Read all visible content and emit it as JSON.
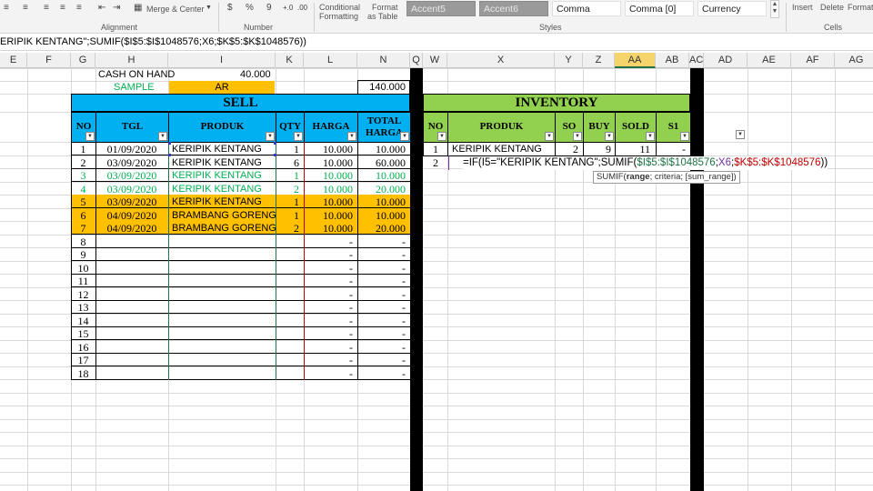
{
  "ribbon": {
    "merge_center": "Merge & Center",
    "percent": "%",
    "comma_sym": "9",
    "alignment_label": "Alignment",
    "number_label": "Number",
    "styles_label": "Styles",
    "cells_label": "Cells",
    "cond_fmt_1": "Conditional",
    "cond_fmt_2": "Formatting",
    "fmt_table_1": "Format",
    "fmt_table_2": "as Table",
    "style_accent5": "Accent5",
    "style_accent6": "Accent6",
    "style_comma": "Comma",
    "style_comma0": "Comma [0]",
    "style_currency": "Currency",
    "insert": "Insert",
    "delete": "Delete",
    "format": "Format"
  },
  "formula_bar": "ERIPIK KENTANG\";SUMIF($I$5:$I$1048576;X6;$K$5:$K$1048576))",
  "columns": [
    "E",
    "F",
    "G",
    "H",
    "I",
    "K",
    "L",
    "N",
    "Q",
    "W",
    "X",
    "Y",
    "Z",
    "AA",
    "AB",
    "AC",
    "AD",
    "AE",
    "AF",
    "AG"
  ],
  "top": {
    "cash_label": "CASH ON HAND",
    "cash_value": "40.000",
    "sample_label": "SAMPLE",
    "ar_label": "AR",
    "n_value": "140.000"
  },
  "sell": {
    "title": "SELL",
    "headers": [
      "NO",
      "TGL",
      "PRODUK",
      "QTY",
      "HARGA",
      "TOTAL HARGA"
    ],
    "rows": [
      {
        "no": "1",
        "tgl": "01/09/2020",
        "produk": "KERIPIK KENTANG",
        "qty": "1",
        "harga": "10.000",
        "total": "10.000",
        "style": "plain"
      },
      {
        "no": "2",
        "tgl": "03/09/2020",
        "produk": "KERIPIK KENTANG",
        "qty": "6",
        "harga": "10.000",
        "total": "60.000",
        "style": "plain"
      },
      {
        "no": "3",
        "tgl": "03/09/2020",
        "produk": "KERIPIK KENTANG",
        "qty": "1",
        "harga": "10.000",
        "total": "10.000",
        "style": "green"
      },
      {
        "no": "4",
        "tgl": "03/09/2020",
        "produk": "KERIPIK KENTANG",
        "qty": "2",
        "harga": "10.000",
        "total": "20.000",
        "style": "green"
      },
      {
        "no": "5",
        "tgl": "03/09/2020",
        "produk": "KERIPIK KENTANG",
        "qty": "1",
        "harga": "10.000",
        "total": "10.000",
        "style": "orange"
      },
      {
        "no": "6",
        "tgl": "04/09/2020",
        "produk": "BRAMBANG GORENG",
        "qty": "1",
        "harga": "10.000",
        "total": "10.000",
        "style": "orange"
      },
      {
        "no": "7",
        "tgl": "04/09/2020",
        "produk": "BRAMBANG GORENG",
        "qty": "2",
        "harga": "10.000",
        "total": "20.000",
        "style": "orange"
      },
      {
        "no": "8",
        "tgl": "",
        "produk": "",
        "qty": "",
        "harga": "-",
        "total": "-",
        "style": "plain"
      },
      {
        "no": "9",
        "tgl": "",
        "produk": "",
        "qty": "",
        "harga": "-",
        "total": "-",
        "style": "plain"
      },
      {
        "no": "10",
        "tgl": "",
        "produk": "",
        "qty": "",
        "harga": "-",
        "total": "-",
        "style": "plain"
      },
      {
        "no": "11",
        "tgl": "",
        "produk": "",
        "qty": "",
        "harga": "-",
        "total": "-",
        "style": "plain"
      },
      {
        "no": "12",
        "tgl": "",
        "produk": "",
        "qty": "",
        "harga": "-",
        "total": "-",
        "style": "plain"
      },
      {
        "no": "13",
        "tgl": "",
        "produk": "",
        "qty": "",
        "harga": "-",
        "total": "-",
        "style": "plain"
      },
      {
        "no": "14",
        "tgl": "",
        "produk": "",
        "qty": "",
        "harga": "-",
        "total": "-",
        "style": "plain"
      },
      {
        "no": "15",
        "tgl": "",
        "produk": "",
        "qty": "",
        "harga": "-",
        "total": "-",
        "style": "plain"
      },
      {
        "no": "16",
        "tgl": "",
        "produk": "",
        "qty": "",
        "harga": "-",
        "total": "-",
        "style": "plain"
      },
      {
        "no": "17",
        "tgl": "",
        "produk": "",
        "qty": "",
        "harga": "-",
        "total": "-",
        "style": "plain"
      },
      {
        "no": "18",
        "tgl": "",
        "produk": "",
        "qty": "",
        "harga": "-",
        "total": "-",
        "style": "plain"
      }
    ]
  },
  "inventory": {
    "title": "INVENTORY",
    "headers": [
      "NO",
      "PRODUK",
      "SO",
      "BUY",
      "SOLD",
      "S1"
    ],
    "row1": {
      "no": "1",
      "produk": "KERIPIK KENTANG",
      "so": "2",
      "buy": "9",
      "sold": "11",
      "s1": "-"
    },
    "row2_no": "2",
    "formula_parts": [
      "=IF(I5=\"KERIPIK KENTANG\";SUMIF(",
      "$I$5:$I$1048576",
      ";",
      "X6",
      ";",
      "$K$5:$K$1048576",
      "))"
    ],
    "tooltip": {
      "fn": "SUMIF(",
      "range": "range",
      "rest": "; criteria; [sum_range])"
    }
  },
  "colors": {
    "sell_header": "#00b0f0",
    "inventory_header": "#92d050",
    "orange": "#ffc000",
    "green_text": "#00b050",
    "sample_text": "#00b050",
    "formula_green": "#217346",
    "formula_purple": "#7030a0",
    "formula_red": "#c00000"
  }
}
